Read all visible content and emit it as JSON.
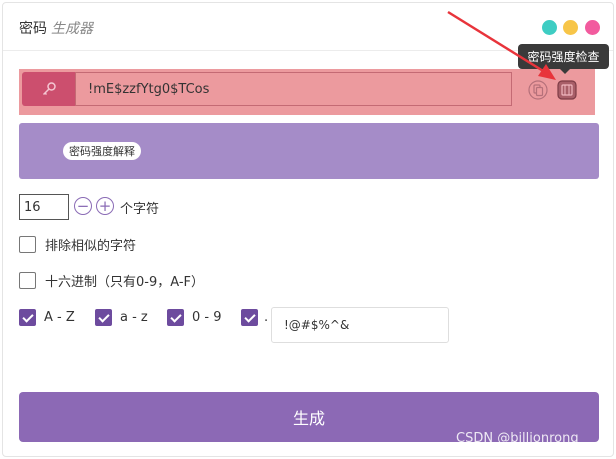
{
  "header": {
    "title": "密码",
    "subtitle": "生成器"
  },
  "window_controls": {
    "colors": [
      "#3ecdc3",
      "#f7c548",
      "#f25b9e"
    ]
  },
  "tooltip": {
    "text": "密码强度检查"
  },
  "password": {
    "value": "!mE$zzfYtg0$TCos",
    "icon": "key-icon",
    "bg_color": "#ec9a9e"
  },
  "strength": {
    "label": "密码强度解释",
    "bg_color": "#a58cc8"
  },
  "length": {
    "value": "16",
    "minus": "−",
    "plus": "+",
    "suffix": "个字符"
  },
  "options": {
    "exclude_similar": {
      "label": "排除相似的字符",
      "checked": false
    },
    "hex_only": {
      "label": "十六进制（只有0-9，A-F）",
      "checked": false
    }
  },
  "charsets": [
    {
      "label": "A - Z",
      "checked": true
    },
    {
      "label": "a - z",
      "checked": true
    },
    {
      "label": "0 - 9",
      "checked": true
    },
    {
      "label": ".",
      "checked": true
    }
  ],
  "symbols": {
    "value": "!@#$%^&"
  },
  "generate": {
    "label": "生成"
  },
  "watermark": {
    "text": "CSDN @billionrong"
  },
  "colors": {
    "accent": "#8c69b5",
    "key_box": "#cc4f6e",
    "checkbox": "#6d4b9e"
  }
}
